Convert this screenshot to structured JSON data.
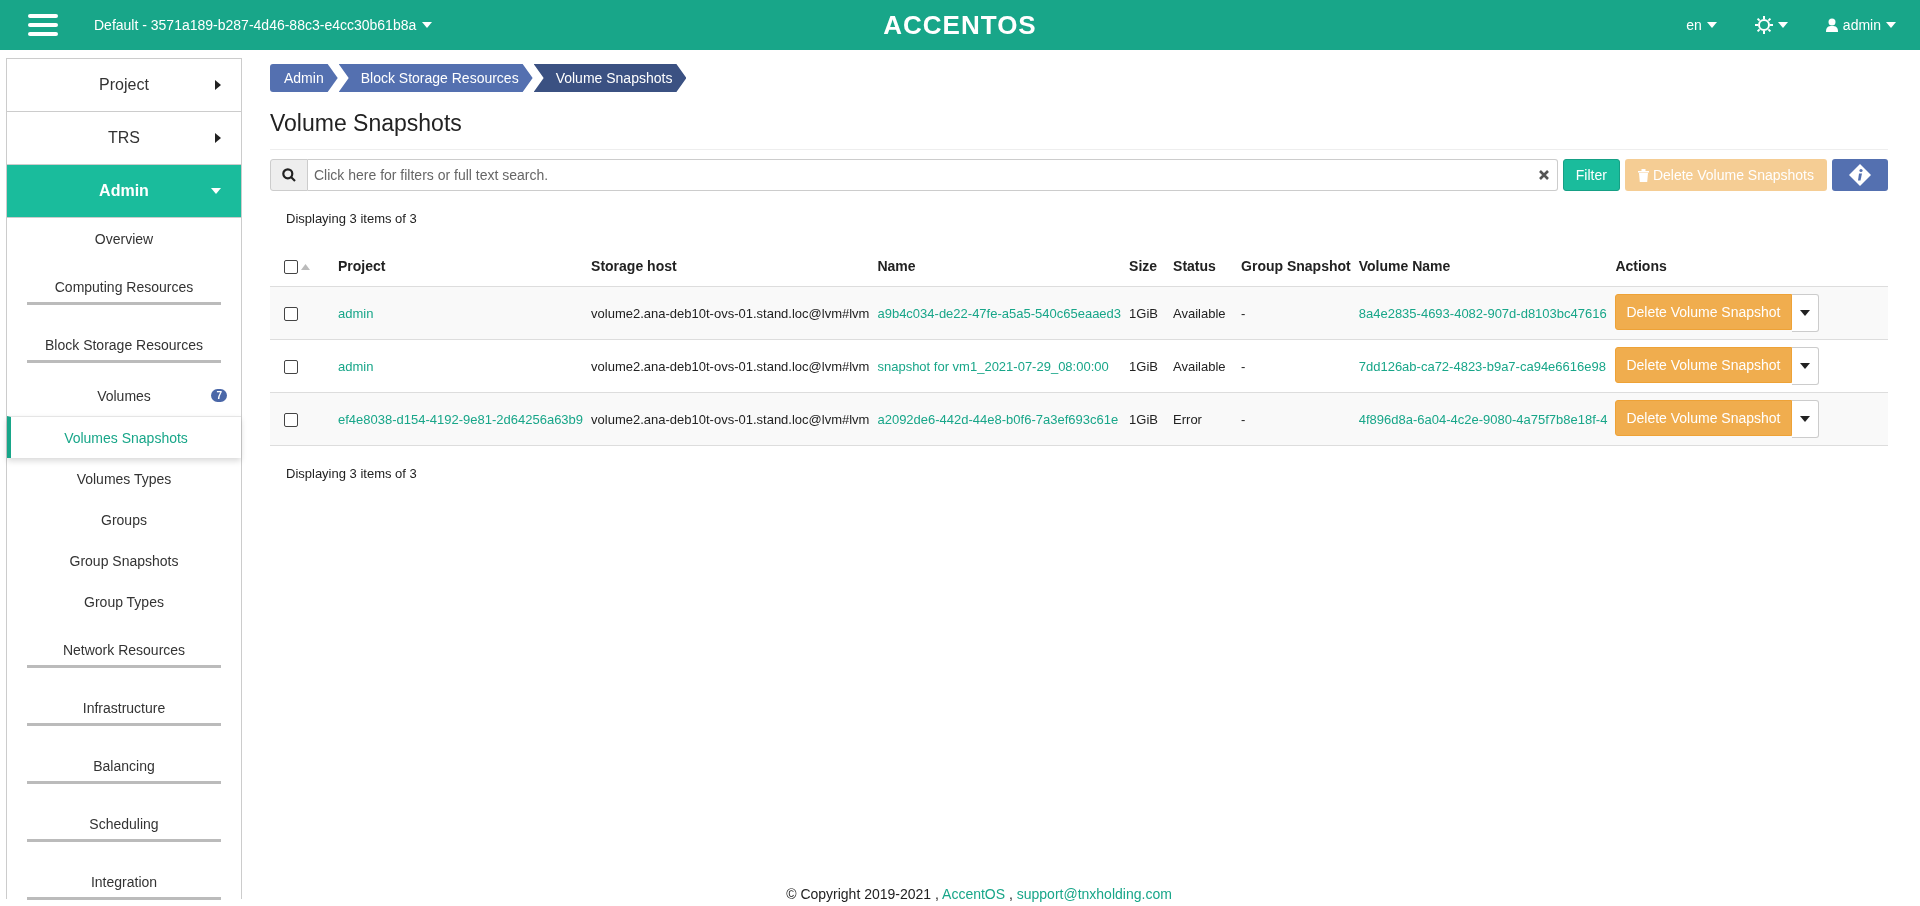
{
  "header": {
    "project_selector": "Default - 3571a189-b287-4d46-88c3-e4cc30b61b8a",
    "logo": "ACCENTOS",
    "language": "en",
    "user": "admin"
  },
  "sidebar": {
    "items": [
      {
        "label": "Project",
        "kind": "section",
        "expanded": false
      },
      {
        "label": "TRS",
        "kind": "section",
        "expanded": false
      },
      {
        "label": "Admin",
        "kind": "section",
        "expanded": true,
        "children": [
          {
            "label": "Overview",
            "kind": "link",
            "selected": false
          },
          {
            "label": "Computing Resources",
            "kind": "group"
          },
          {
            "label": "Block Storage Resources",
            "kind": "group",
            "children": [
              {
                "label": "Volumes",
                "kind": "link",
                "selected": false,
                "badge": "7"
              },
              {
                "label": "Volumes Snapshots",
                "kind": "link",
                "selected": true
              },
              {
                "label": "Volumes Types",
                "kind": "link",
                "selected": false
              },
              {
                "label": "Groups",
                "kind": "link",
                "selected": false
              },
              {
                "label": "Group Snapshots",
                "kind": "link",
                "selected": false
              },
              {
                "label": "Group Types",
                "kind": "link",
                "selected": false
              }
            ]
          },
          {
            "label": "Network Resources",
            "kind": "group"
          },
          {
            "label": "Infrastructure",
            "kind": "group"
          },
          {
            "label": "Balancing",
            "kind": "group"
          },
          {
            "label": "Scheduling",
            "kind": "group"
          },
          {
            "label": "Integration",
            "kind": "group"
          }
        ]
      }
    ]
  },
  "breadcrumb": [
    {
      "label": "Admin",
      "selected": false
    },
    {
      "label": "Block Storage Resources",
      "selected": false
    },
    {
      "label": "Volume Snapshots",
      "selected": true
    }
  ],
  "page_title": "Volume Snapshots",
  "toolbar": {
    "search": {
      "placeholder": "Click here for filters or full text search."
    },
    "filter_button": "Filter",
    "delete_button": {
      "label": "Delete Volume Snapshots",
      "disabled": true
    }
  },
  "summary_top": "Displaying 3 items of 3",
  "table": {
    "select_all": {
      "checked": false
    },
    "columns": [
      "Project",
      "Storage host",
      "Name",
      "Size",
      "Status",
      "Group Snapshot",
      "Volume Name",
      "Actions"
    ],
    "rows": [
      {
        "checked": false,
        "project": "admin",
        "storage_host": "volume2.ana-deb10t-ovs-01.stand.loc@lvm#lvm",
        "name": "a9b4c034-de22-47fe-a5a5-540c65eaaed3",
        "size": "1GiB",
        "status": "Available",
        "group_snapshot": "-",
        "volume_name": "8a4e2835-4693-4082-907d-d8103bc47616",
        "action": "Delete Volume Snapshot"
      },
      {
        "checked": false,
        "project": "admin",
        "storage_host": "volume2.ana-deb10t-ovs-01.stand.loc@lvm#lvm",
        "name": "snapshot for vm1_2021-07-29_08:00:00",
        "size": "1GiB",
        "status": "Available",
        "group_snapshot": "-",
        "volume_name": "7dd126ab-ca72-4823-b9a7-ca94e6616e98",
        "action": "Delete Volume Snapshot"
      },
      {
        "checked": false,
        "project": "ef4e8038-d154-4192-9e81-2d64256a63b9",
        "storage_host": "volume2.ana-deb10t-ovs-01.stand.loc@lvm#lvm",
        "name": "a2092de6-442d-44e8-b0f6-7a3ef693c61e",
        "size": "1GiB",
        "status": "Error",
        "group_snapshot": "-",
        "volume_name": "4f896d8a-6a04-4c2e-9080-4a75f7b8e18f-4",
        "action": "Delete Volume Snapshot"
      }
    ]
  },
  "summary_bottom": "Displaying 3 items of 3",
  "footer": {
    "copyright": "© Copyright 2019-2021 ,",
    "product_link": "AccentOS",
    "separator": ",",
    "email_link": "support@tnxholding.com"
  }
}
